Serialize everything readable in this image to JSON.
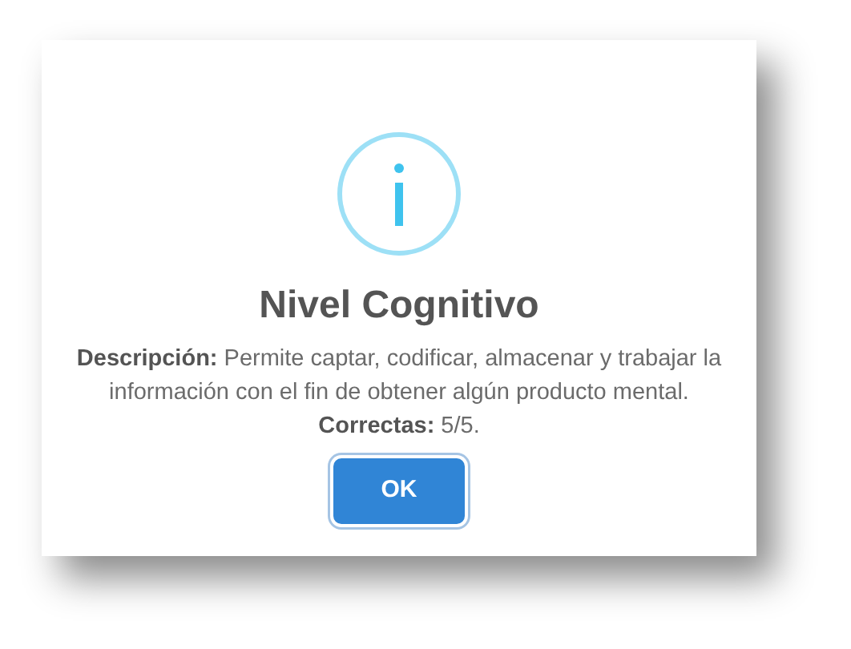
{
  "dialog": {
    "kind": "info",
    "title": "Nivel Cognitivo",
    "description": "**Descripción:** Permite captar, codificar, almacenar y trabajar la información con el fin de obtener algún producto mental.",
    "score": "**Correctas:** 5/5.",
    "buttons": [
      {
        "label": "OK",
        "focused": true
      }
    ]
  }
}
